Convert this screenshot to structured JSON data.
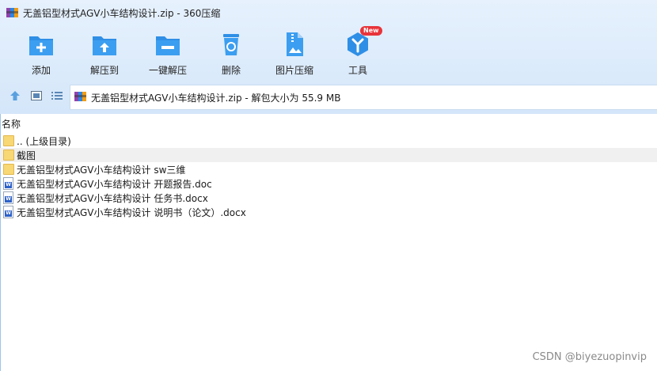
{
  "window": {
    "title": "无盖铝型材式AGV小车结构设计.zip - 360压缩",
    "app_icon": "winrar-books-icon"
  },
  "toolbar": {
    "items": [
      {
        "label": "添加",
        "icon": "add-icon"
      },
      {
        "label": "解压到",
        "icon": "extract-to-icon"
      },
      {
        "label": "一键解压",
        "icon": "one-click-extract-icon"
      },
      {
        "label": "删除",
        "icon": "delete-icon"
      },
      {
        "label": "图片压缩",
        "icon": "image-compress-icon"
      },
      {
        "label": "工具",
        "icon": "tools-icon",
        "badge": "New"
      }
    ]
  },
  "navbar": {
    "address": "无盖铝型材式AGV小车结构设计.zip - 解包大小为 55.9 MB"
  },
  "list": {
    "column_name": "名称",
    "rows": [
      {
        "name": ".. (上级目录)",
        "type": "folder"
      },
      {
        "name": "截图",
        "type": "folder",
        "selected": true
      },
      {
        "name": "无盖铝型材式AGV小车结构设计 sw三维",
        "type": "folder"
      },
      {
        "name": "无盖铝型材式AGV小车结构设计 开题报告.doc",
        "type": "word"
      },
      {
        "name": "无盖铝型材式AGV小车结构设计 任务书.docx",
        "type": "word"
      },
      {
        "name": "无盖铝型材式AGV小车结构设计 说明书（论文）.docx",
        "type": "word"
      }
    ]
  },
  "watermark": "CSDN @biyezuopinvip",
  "colors": {
    "accent": "#2f8fe6",
    "badge": "#e8343a",
    "folder": "#f8d775"
  }
}
